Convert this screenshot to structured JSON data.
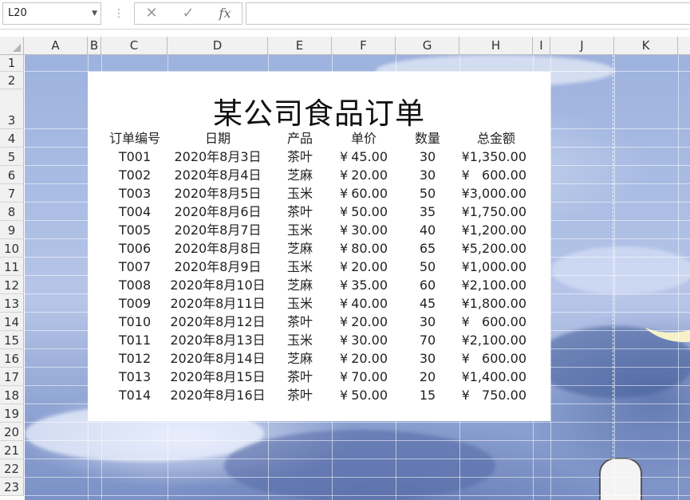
{
  "formula_bar": {
    "name_box": "L20",
    "cancel_glyph": "✕",
    "confirm_glyph": "✓",
    "fx_label": "fx",
    "formula": ""
  },
  "columns": [
    "A",
    "B",
    "C",
    "D",
    "E",
    "F",
    "G",
    "H",
    "I",
    "J",
    "K"
  ],
  "rows": [
    "1",
    "2",
    "3",
    "4",
    "5",
    "6",
    "7",
    "8",
    "9",
    "10",
    "11",
    "12",
    "13",
    "14",
    "15",
    "16",
    "17",
    "18",
    "19",
    "20",
    "21",
    "22",
    "23"
  ],
  "sheet": {
    "title": "某公司食品订单",
    "headers": {
      "id": "订单编号",
      "date": "日期",
      "product": "产品",
      "price": "单价",
      "qty": "数量",
      "total": "总金额"
    },
    "currency": "¥",
    "orders": [
      {
        "id": "T001",
        "date": "2020年8月3日",
        "product": "茶叶",
        "price": "45.00",
        "qty": "30",
        "total": "¥1,350.00"
      },
      {
        "id": "T002",
        "date": "2020年8月4日",
        "product": "芝麻",
        "price": "20.00",
        "qty": "30",
        "total": "¥   600.00"
      },
      {
        "id": "T003",
        "date": "2020年8月5日",
        "product": "玉米",
        "price": "60.00",
        "qty": "50",
        "total": "¥3,000.00"
      },
      {
        "id": "T004",
        "date": "2020年8月6日",
        "product": "茶叶",
        "price": "50.00",
        "qty": "35",
        "total": "¥1,750.00"
      },
      {
        "id": "T005",
        "date": "2020年8月7日",
        "product": "玉米",
        "price": "30.00",
        "qty": "40",
        "total": "¥1,200.00"
      },
      {
        "id": "T006",
        "date": "2020年8月8日",
        "product": "芝麻",
        "price": "80.00",
        "qty": "65",
        "total": "¥5,200.00"
      },
      {
        "id": "T007",
        "date": "2020年8月9日",
        "product": "玉米",
        "price": "20.00",
        "qty": "50",
        "total": "¥1,000.00"
      },
      {
        "id": "T008",
        "date": "2020年8月10日",
        "product": "芝麻",
        "price": "35.00",
        "qty": "60",
        "total": "¥2,100.00"
      },
      {
        "id": "T009",
        "date": "2020年8月11日",
        "product": "玉米",
        "price": "40.00",
        "qty": "45",
        "total": "¥1,800.00"
      },
      {
        "id": "T010",
        "date": "2020年8月12日",
        "product": "茶叶",
        "price": "20.00",
        "qty": "30",
        "total": "¥   600.00"
      },
      {
        "id": "T011",
        "date": "2020年8月13日",
        "product": "玉米",
        "price": "30.00",
        "qty": "70",
        "total": "¥2,100.00"
      },
      {
        "id": "T012",
        "date": "2020年8月14日",
        "product": "芝麻",
        "price": "20.00",
        "qty": "30",
        "total": "¥   600.00"
      },
      {
        "id": "T013",
        "date": "2020年8月15日",
        "product": "茶叶",
        "price": "70.00",
        "qty": "20",
        "total": "¥1,400.00"
      },
      {
        "id": "T014",
        "date": "2020年8月16日",
        "product": "茶叶",
        "price": "50.00",
        "qty": "15",
        "total": "¥   750.00"
      }
    ]
  }
}
